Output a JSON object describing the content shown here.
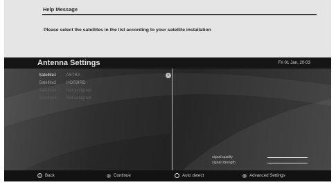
{
  "help": {
    "title": "Help Message",
    "message": "Please select the satellites in the list according to your satellite installation"
  },
  "panel": {
    "title": "Antenna Settings",
    "datetime": "Fri 01 Jan, 20:03"
  },
  "satellites": [
    {
      "label": "Satellite1",
      "value": "ASTRA"
    },
    {
      "label": "Satellite2",
      "value": "HOTBIRD"
    },
    {
      "label": "Satellite3",
      "value": "Not assigned"
    },
    {
      "label": "Satellite4",
      "value": "Not assigned"
    }
  ],
  "signal": {
    "quality_label": "signal quality",
    "strength_label": "signal strength"
  },
  "footer": {
    "back": "Back",
    "continue": "Continue",
    "auto_detect": "Auto detect",
    "advanced": "Advanced Settings"
  },
  "icons": {
    "chevron": "chevron-right-icon"
  }
}
